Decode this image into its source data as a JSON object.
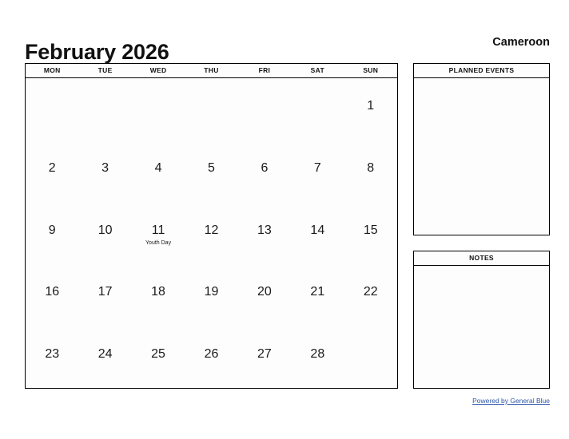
{
  "header": {
    "title": "February 2026",
    "country": "Cameroon"
  },
  "calendar": {
    "weekdays": [
      "MON",
      "TUE",
      "WED",
      "THU",
      "FRI",
      "SAT",
      "SUN"
    ],
    "weeks": [
      [
        {
          "day": ""
        },
        {
          "day": ""
        },
        {
          "day": ""
        },
        {
          "day": ""
        },
        {
          "day": ""
        },
        {
          "day": ""
        },
        {
          "day": "1"
        }
      ],
      [
        {
          "day": "2"
        },
        {
          "day": "3"
        },
        {
          "day": "4"
        },
        {
          "day": "5"
        },
        {
          "day": "6"
        },
        {
          "day": "7"
        },
        {
          "day": "8"
        }
      ],
      [
        {
          "day": "9"
        },
        {
          "day": "10"
        },
        {
          "day": "11",
          "event": "Youth Day"
        },
        {
          "day": "12"
        },
        {
          "day": "13"
        },
        {
          "day": "14"
        },
        {
          "day": "15"
        }
      ],
      [
        {
          "day": "16"
        },
        {
          "day": "17"
        },
        {
          "day": "18"
        },
        {
          "day": "19"
        },
        {
          "day": "20"
        },
        {
          "day": "21"
        },
        {
          "day": "22"
        }
      ],
      [
        {
          "day": "23"
        },
        {
          "day": "24"
        },
        {
          "day": "25"
        },
        {
          "day": "26"
        },
        {
          "day": "27"
        },
        {
          "day": "28"
        },
        {
          "day": ""
        }
      ]
    ]
  },
  "panels": [
    {
      "id": "planned-events",
      "title": "PLANNED EVENTS",
      "content": ""
    },
    {
      "id": "notes",
      "title": "NOTES",
      "content": ""
    }
  ],
  "footer": {
    "link_text": "Powered by General Blue"
  },
  "colors": {
    "link": "#2c55a8",
    "border": "#000000",
    "text": "#111111",
    "page_background": "#ffffff",
    "panel_background": "#fdfdfd"
  }
}
